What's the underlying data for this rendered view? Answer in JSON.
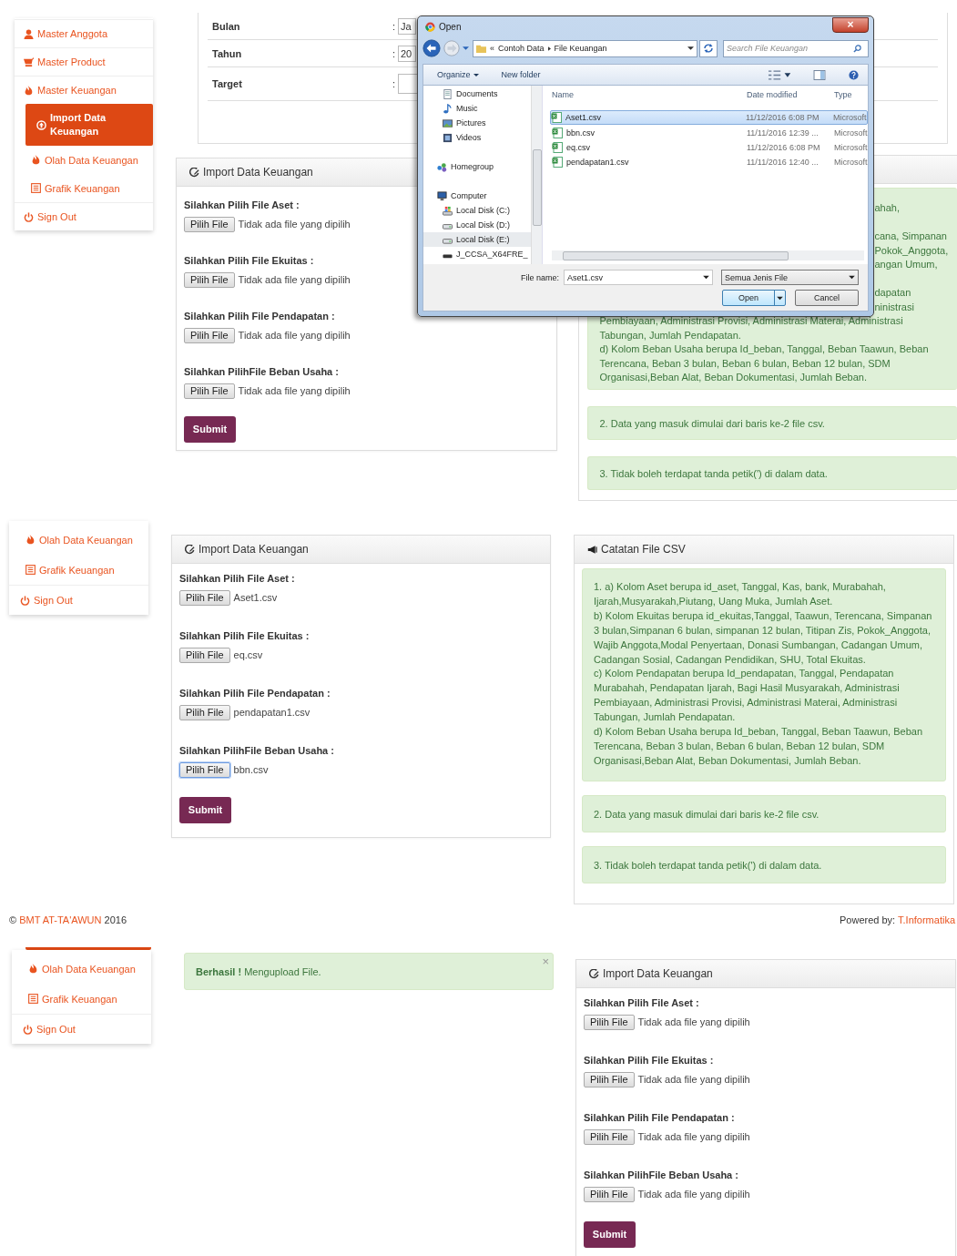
{
  "top_capture": {
    "sidebar": [
      {
        "label": "Master Anggota",
        "kind": "anggota",
        "selected": false
      },
      {
        "label": "Master Product",
        "kind": "product",
        "selected": false
      },
      {
        "label": "Master Keuangan",
        "kind": "keuangan",
        "selected": false
      },
      {
        "label": "Import Data Keuangan",
        "kind": "import",
        "selected": true
      },
      {
        "label": "Olah Data Keuangan",
        "kind": "olah",
        "selected": false
      },
      {
        "label": "Grafik Keuangan",
        "kind": "grafik",
        "selected": false
      },
      {
        "label": "Sign Out",
        "kind": "signout",
        "selected": false
      }
    ],
    "target_form": [
      {
        "label": "Bulan",
        "colon": ":",
        "value": "Ja"
      },
      {
        "label": "Tahun",
        "colon": ":",
        "value": "20"
      },
      {
        "label": "Target",
        "colon": ":"
      }
    ],
    "import_form": {
      "title": "Import Data Keuangan",
      "submit": "Submit",
      "fields": [
        {
          "label": "Silahkan Pilih File Aset :",
          "button": "Pilih File",
          "status": "Tidak ada file yang dipilih",
          "focused": false
        },
        {
          "label": "Silahkan Pilih File Ekuitas :",
          "button": "Pilih File",
          "status": "Tidak ada file yang dipilih",
          "focused": false
        },
        {
          "label": "Silahkan Pilih File Pendapatan :",
          "button": "Pilih File",
          "status": "Tidak ada file yang dipilih",
          "focused": false
        },
        {
          "label": "Silahkan PilihFile Beban Usaha :",
          "button": "Pilih File",
          "status": "Tidak ada file yang dipilih",
          "focused": false
        }
      ]
    },
    "notes": {
      "fragments": [
        {
          "text": "ahah,"
        },
        {
          "text": "cana, Simpanan"
        },
        {
          "text": "Pokok_Anggota,"
        },
        {
          "text": "angan Umum,"
        },
        {
          "text": "dapatan"
        },
        {
          "text": "ninistrasi"
        }
      ],
      "lines": [
        "Pembiayaan, Administrasi Provisi, Administrasi Materai, Administrasi",
        "Tabungan, Jumlah Pendapatan.",
        "d) Kolom Beban Usaha berupa Id_beban, Tanggal, Beban Taawun, Beban Terencana, Beban 3 bulan, Beban 6 bulan, Beban 12 bulan, SDM Organisasi,Beban Alat, Beban Dokumentasi, Jumlah Beban."
      ],
      "more": [
        "2. Data yang masuk dimulai dari baris ke-2 file csv.",
        "3. Tidak boleh terdapat tanda petik(') di dalam data."
      ]
    },
    "dialog": {
      "title": "Open",
      "close": "×",
      "back_guard": "«",
      "path": [
        "Contoh Data",
        "File Keuangan"
      ],
      "search_placeholder": "Search File Keuangan",
      "toolbar": [
        "Organize",
        "New folder"
      ],
      "nav": [
        {
          "label": "Documents",
          "kind": "documents",
          "selected": false
        },
        {
          "label": "Music",
          "kind": "music",
          "selected": false
        },
        {
          "label": "Pictures",
          "kind": "pictures",
          "selected": false
        },
        {
          "label": "Videos",
          "kind": "videos",
          "selected": false
        },
        {
          "label": "Homegroup",
          "kind": "homegroup",
          "selected": false
        },
        {
          "label": "Computer",
          "kind": "computer",
          "selected": false
        },
        {
          "label": "Local Disk (C:)",
          "kind": "system-disk",
          "selected": false
        },
        {
          "label": "Local Disk (D:)",
          "kind": "disk",
          "selected": false
        },
        {
          "label": "Local Disk (E:)",
          "kind": "disk",
          "selected": true
        },
        {
          "label": "J_CCSA_X64FRE_",
          "kind": "drive",
          "selected": false
        }
      ],
      "columns": [
        "Name",
        "Date modified",
        "Type"
      ],
      "files": [
        {
          "name": "Aset1.csv",
          "date": "11/12/2016 6:08 PM",
          "type": "Microsoft",
          "selected": true
        },
        {
          "name": "bbn.csv",
          "date": "11/11/2016 12:39 ...",
          "type": "Microsoft",
          "selected": false
        },
        {
          "name": "eq.csv",
          "date": "11/12/2016 6:08 PM",
          "type": "Microsoft",
          "selected": false
        },
        {
          "name": "pendapatan1.csv",
          "date": "11/11/2016 12:40 ...",
          "type": "Microsoft",
          "selected": false
        }
      ],
      "file_name_label": "File name:",
      "file_name": "Aset1.csv",
      "filter": "Semua Jenis File",
      "buttons": [
        "Open",
        "Cancel"
      ]
    }
  },
  "middle_capture": {
    "sidebar": [
      {
        "label": "Olah Data Keuangan",
        "kind": "olah",
        "selected": false
      },
      {
        "label": "Grafik Keuangan",
        "kind": "grafik",
        "selected": false
      },
      {
        "label": "Sign Out",
        "kind": "signout",
        "selected": false
      }
    ],
    "import_form": {
      "title": "Import Data Keuangan",
      "submit": "Submit",
      "fields": [
        {
          "label": "Silahkan Pilih File Aset :",
          "button": "Pilih File",
          "status": "Aset1.csv",
          "focused": false
        },
        {
          "label": "Silahkan Pilih File Ekuitas :",
          "button": "Pilih File",
          "status": "eq.csv",
          "focused": false
        },
        {
          "label": "Silahkan Pilih File Pendapatan :",
          "button": "Pilih File",
          "status": "pendapatan1.csv",
          "focused": false
        },
        {
          "label": "Silahkan PilihFile Beban Usaha :",
          "button": "Pilih File",
          "status": "bbn.csv",
          "focused": true
        }
      ]
    },
    "notes": {
      "title": "Catatan File CSV",
      "first": [
        "1. a) Kolom Aset berupa id_aset, Tanggal, Kas, bank, Murabahah, Ijarah,Musyarakah,Piutang, Uang Muka, Jumlah Aset.",
        "b) Kolom Ekuitas berupa id_ekuitas,Tanggal, Taawun, Terencana, Simpanan 3 bulan,Simpanan 6 bulan, simpanan 12 bulan, Titipan Zis, Pokok_Anggota, Wajib Anggota,Modal Penyertaan, Donasi Sumbangan, Cadangan Umum, Cadangan Sosial, Cadangan Pendidikan, SHU, Total Ekuitas.",
        "c) Kolom Pendapatan berupa Id_pendapatan, Tanggal, Pendapatan Murabahah, Pendapatan Ijarah, Bagi Hasil Musyarakah, Administrasi Pembiayaan, Administrasi Provisi, Administrasi Materai, Administrasi Tabungan, Jumlah Pendapatan.",
        "d) Kolom Beban Usaha berupa Id_beban, Tanggal, Beban Taawun, Beban Terencana, Beban 3 bulan, Beban 6 bulan, Beban 12 bulan, SDM Organisasi,Beban Alat, Beban Dokumentasi, Jumlah Beban."
      ],
      "more": [
        "2. Data yang masuk dimulai dari baris ke-2 file csv.",
        "3. Tidak boleh terdapat tanda petik(') di dalam data."
      ]
    },
    "footer": {
      "copyright": "©",
      "brand": "BMT AT-TA'AWUN",
      "year": "2016",
      "powered_label": "Powered by:",
      "powered_link": "T.Informatika"
    }
  },
  "bottom_capture": {
    "selected_item_edge": true,
    "sidebar": [
      {
        "label": "Olah Data Keuangan",
        "kind": "olah",
        "selected": false
      },
      {
        "label": "Grafik Keuangan",
        "kind": "grafik",
        "selected": false
      },
      {
        "label": "Sign Out",
        "kind": "signout",
        "selected": false
      }
    ],
    "alert": {
      "strong": "Berhasil !",
      "message": "Mengupload File.",
      "close": "×"
    },
    "import_form": {
      "title": "Import Data Keuangan",
      "submit": "Submit",
      "fields": [
        {
          "label": "Silahkan Pilih File Aset :",
          "button": "Pilih File",
          "status": "Tidak ada file yang dipilih",
          "focused": false
        },
        {
          "label": "Silahkan Pilih File Ekuitas :",
          "button": "Pilih File",
          "status": "Tidak ada file yang dipilih",
          "focused": false
        },
        {
          "label": "Silahkan Pilih File Pendapatan :",
          "button": "Pilih File",
          "status": "Tidak ada file yang dipilih",
          "focused": false
        },
        {
          "label": "Silahkan PilihFile Beban Usaha :",
          "button": "Pilih File",
          "status": "Tidak ada file yang dipilih",
          "focused": false
        }
      ]
    }
  }
}
